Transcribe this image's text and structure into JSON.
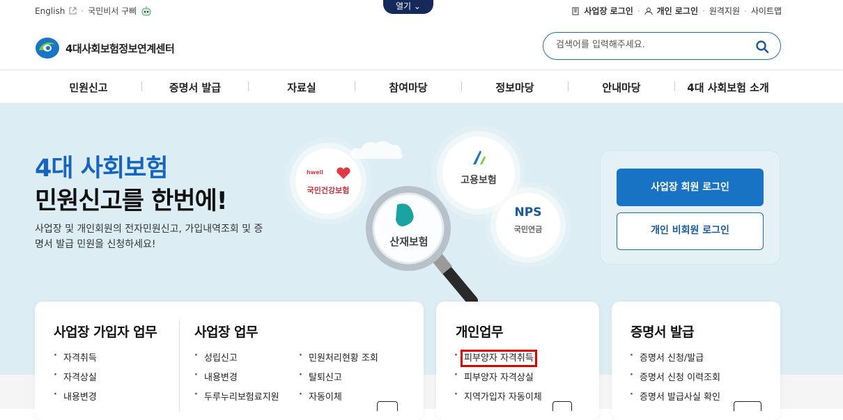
{
  "utility": {
    "english": "English",
    "sep": "·",
    "kiosk": "국민비서 구삐",
    "open": "열기",
    "biz_login": "사업장 로그인",
    "person_login": "개인 로그인",
    "remote": "원격지원",
    "sitemap": "사이트맵"
  },
  "logo": {
    "text": "4대사회보험정보연계센터"
  },
  "search": {
    "placeholder": "검색어를 입력해주세요."
  },
  "gnb": [
    "민원신고",
    "증명서 발급",
    "자료실",
    "참여마당",
    "정보마당",
    "안내마당",
    "4대 사회보험 소개"
  ],
  "hero": {
    "title1": "4대 사회보험",
    "title2": "민원신고를 한번에!",
    "desc": "사업장 및 개인회원의 전자민원신고, 가입내역조회 및 증명서 발급 민원을 신청하세요!"
  },
  "bubbles": {
    "health_brand": "hwell",
    "health": "국민건강보험",
    "employment": "고용보험",
    "nps_brand": "NPS",
    "nps": "국민연금",
    "industrial": "산재보험"
  },
  "login": {
    "biz": "사업장 회원 로그인",
    "person": "개인 비회원 로그인"
  },
  "cards": {
    "biz_member": {
      "title": "사업장 가입자 업무",
      "items": [
        "자격취득",
        "자격상실",
        "내용변경"
      ]
    },
    "biz": {
      "title": "사업장 업무",
      "col1": [
        "성립신고",
        "내용변경",
        "두루누리보험료지원"
      ],
      "col2": [
        "민원처리현황 조회",
        "탈퇴신고",
        "자동이체"
      ]
    },
    "personal": {
      "title": "개인업무",
      "items": [
        "피부양자 자격취득",
        "피부양자 자격상실",
        "지역가입자 자동이체"
      ]
    },
    "cert": {
      "title": "증명서 발급",
      "items": [
        "증명서 신청/발급",
        "증명서 신청 이력조회",
        "증명서 발급사실 확인"
      ]
    }
  },
  "colors": {
    "brand_blue": "#1873c4",
    "navy": "#15295a",
    "hero_bg": "#dcedf3",
    "highlight": "#e00000"
  }
}
